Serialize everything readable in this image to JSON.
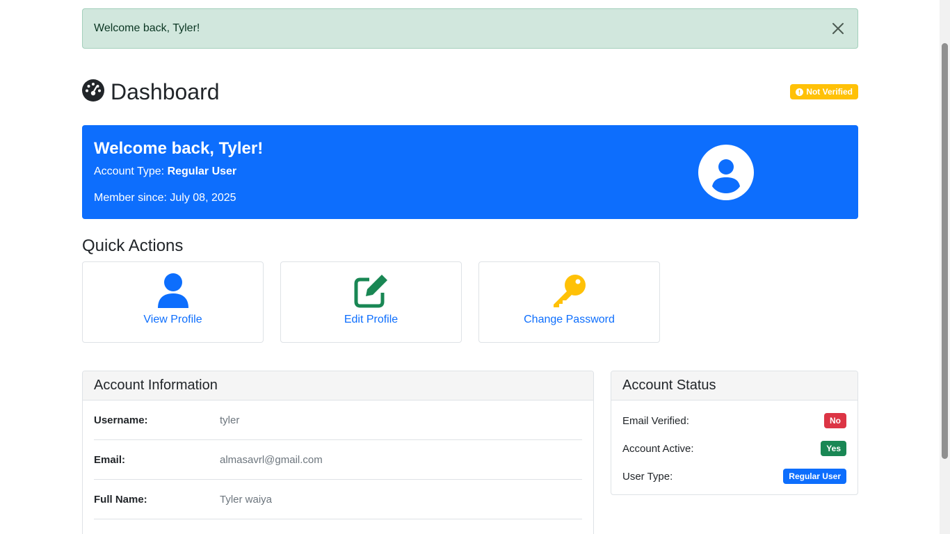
{
  "alert": {
    "message": "Welcome back, Tyler!"
  },
  "page": {
    "title": "Dashboard",
    "verification_badge": "Not Verified"
  },
  "hero": {
    "heading": "Welcome back, Tyler!",
    "account_type_label": "Account Type:",
    "account_type_value": "Regular User",
    "member_since": "Member since: July 08, 2025"
  },
  "quick_actions": {
    "title": "Quick Actions",
    "items": [
      {
        "label": "View Profile",
        "icon": "user-icon"
      },
      {
        "label": "Edit Profile",
        "icon": "edit-icon"
      },
      {
        "label": "Change Password",
        "icon": "key-icon"
      }
    ]
  },
  "account_info": {
    "title": "Account Information",
    "rows": [
      {
        "label": "Username:",
        "value": "tyler"
      },
      {
        "label": "Email:",
        "value": "almasavrl@gmail.com"
      },
      {
        "label": "Full Name:",
        "value": "Tyler waiya"
      }
    ]
  },
  "account_status": {
    "title": "Account Status",
    "rows": [
      {
        "label": "Email Verified:",
        "value": "No",
        "color": "#dc3545"
      },
      {
        "label": "Account Active:",
        "value": "Yes",
        "color": "#198754"
      },
      {
        "label": "User Type:",
        "value": "Regular User",
        "color": "#0d6efd"
      }
    ]
  },
  "colors": {
    "primary": "#0d6efd",
    "success": "#198754",
    "danger": "#dc3545",
    "warning": "#ffc107"
  }
}
